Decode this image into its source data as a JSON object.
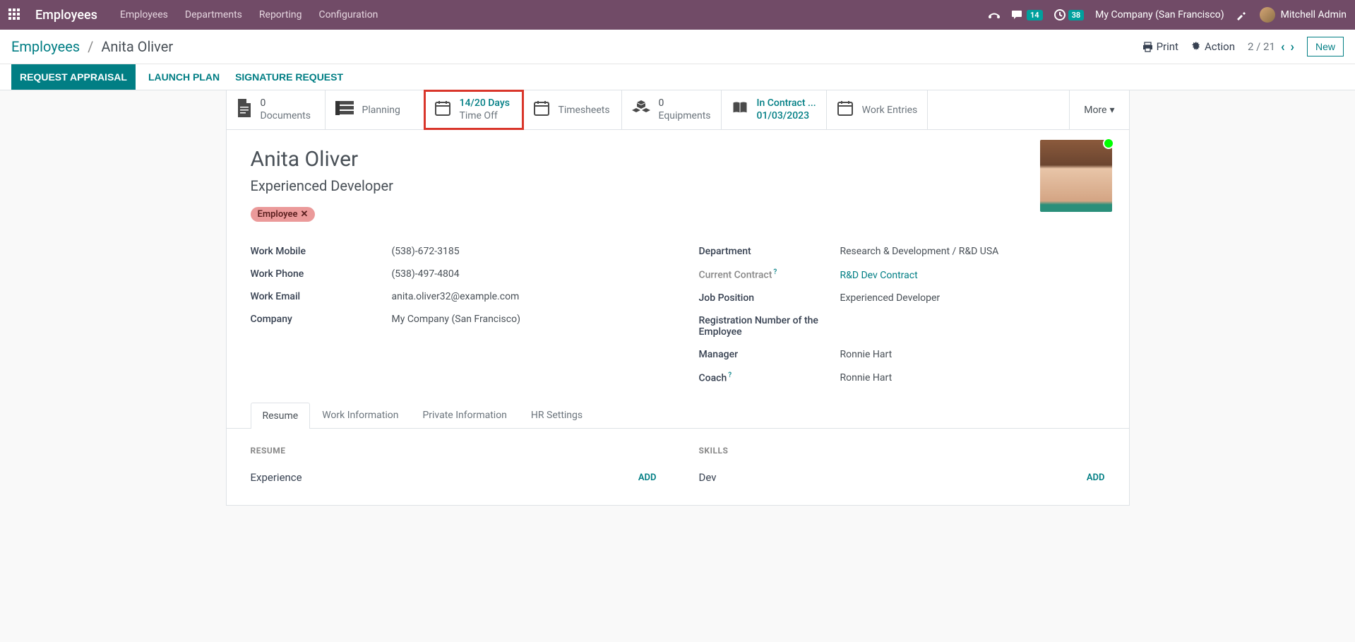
{
  "topbar": {
    "app_title": "Employees",
    "menu": [
      "Employees",
      "Departments",
      "Reporting",
      "Configuration"
    ],
    "msg_badge": "14",
    "activity_badge": "38",
    "company": "My Company (San Francisco)",
    "user": "Mitchell Admin"
  },
  "breadcrumb": {
    "root": "Employees",
    "current": "Anita Oliver",
    "print_label": "Print",
    "action_label": "Action",
    "pager": "2 / 21",
    "new_label": "New"
  },
  "status_buttons": {
    "appraisal": "Request Appraisal",
    "launch": "Launch Plan",
    "signature": "Signature Request"
  },
  "stat_boxes": {
    "documents": {
      "value": "0",
      "label": "Documents"
    },
    "planning": {
      "label": "Planning"
    },
    "timeoff": {
      "value": "14/20 Days",
      "label": "Time Off"
    },
    "timesheets": {
      "label": "Timesheets"
    },
    "equipments": {
      "value": "0",
      "label": "Equipments"
    },
    "contract": {
      "value": "In Contract ...",
      "label": "01/03/2023"
    },
    "work_entries": {
      "label": "Work Entries"
    },
    "more": "More"
  },
  "employee": {
    "name": "Anita Oliver",
    "job_title": "Experienced Developer",
    "tag": "Employee"
  },
  "fields_left": {
    "work_mobile_label": "Work Mobile",
    "work_mobile": "(538)-672-3185",
    "work_phone_label": "Work Phone",
    "work_phone": "(538)-497-4804",
    "work_email_label": "Work Email",
    "work_email": "anita.oliver32@example.com",
    "company_label": "Company",
    "company": "My Company (San Francisco)"
  },
  "fields_right": {
    "department_label": "Department",
    "department": "Research & Development / R&D USA",
    "contract_label": "Current Contract",
    "contract": "R&D Dev Contract",
    "job_position_label": "Job Position",
    "job_position": "Experienced Developer",
    "reg_num_label": "Registration Number of the Employee",
    "reg_num": "",
    "manager_label": "Manager",
    "manager": "Ronnie Hart",
    "coach_label": "Coach",
    "coach": "Ronnie Hart"
  },
  "tabs": [
    "Resume",
    "Work Information",
    "Private Information",
    "HR Settings"
  ],
  "resume": {
    "heading": "RESUME",
    "experience_label": "Experience",
    "skills_heading": "SKILLS",
    "dev_label": "Dev",
    "add_label": "ADD"
  }
}
